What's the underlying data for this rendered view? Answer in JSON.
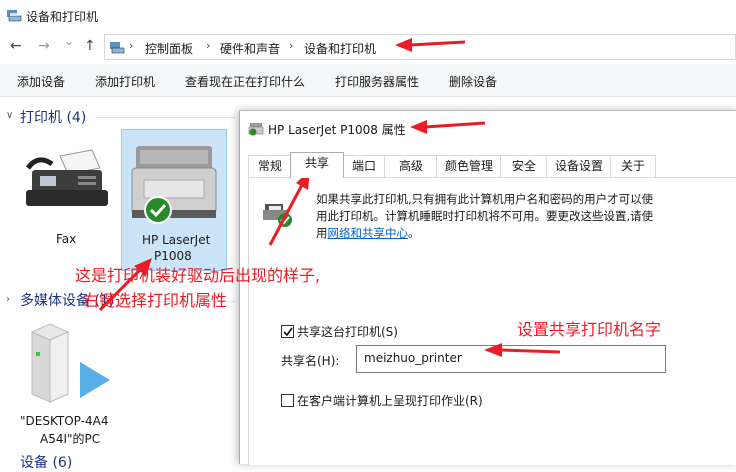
{
  "window": {
    "title": "设备和打印机"
  },
  "nav": {
    "back": "←",
    "forward": "→",
    "dropdown": "⌄",
    "up": "↑"
  },
  "breadcrumb": [
    "控制面板",
    "硬件和声音",
    "设备和打印机"
  ],
  "breadcrumb_sep": "›",
  "commands": [
    "添加设备",
    "添加打印机",
    "查看现在正在打印什么",
    "打印服务器属性",
    "删除设备"
  ],
  "groups": {
    "printers": "打印机 (4)",
    "multimedia": "多媒体设备 (1)",
    "devices": "设备 (6)"
  },
  "devices": {
    "fax": "Fax",
    "hp_line1": "HP LaserJet",
    "hp_line2": "P1008",
    "pc_line1": "\"DESKTOP-4A4",
    "pc_line2": "A54I\"的PC"
  },
  "annotations": {
    "note_line1": "这是打印机装好驱动后出现的样子,",
    "note_line2": "右键选择打印机属性",
    "note_share": "设置共享打印机名字"
  },
  "dialog": {
    "title": "HP LaserJet P1008 属性",
    "tabs": [
      "常规",
      "共享",
      "端口",
      "高级",
      "颜色管理",
      "安全",
      "设备设置",
      "关于"
    ],
    "active_tab": "共享",
    "info_line1": "如果共享此打印机,只有拥有此计算机用户名和密码的用户才可以使",
    "info_line2": "用此打印机。计算机睡眠时打印机将不可用。要更改这些设置,请使",
    "info_line3_pre": "用",
    "info_link": "网络和共享中心",
    "info_line3_post": "。",
    "share_checkbox": "共享这台打印机(S)",
    "share_checked": true,
    "share_name_label": "共享名(H):",
    "share_name_value": "meizhuo_printer",
    "render_checkbox": "在客户端计算机上呈现打印作业(R)",
    "render_checked": false
  },
  "colors": {
    "annotation_red": "#ec1c24",
    "group_header": "#1e3287"
  }
}
